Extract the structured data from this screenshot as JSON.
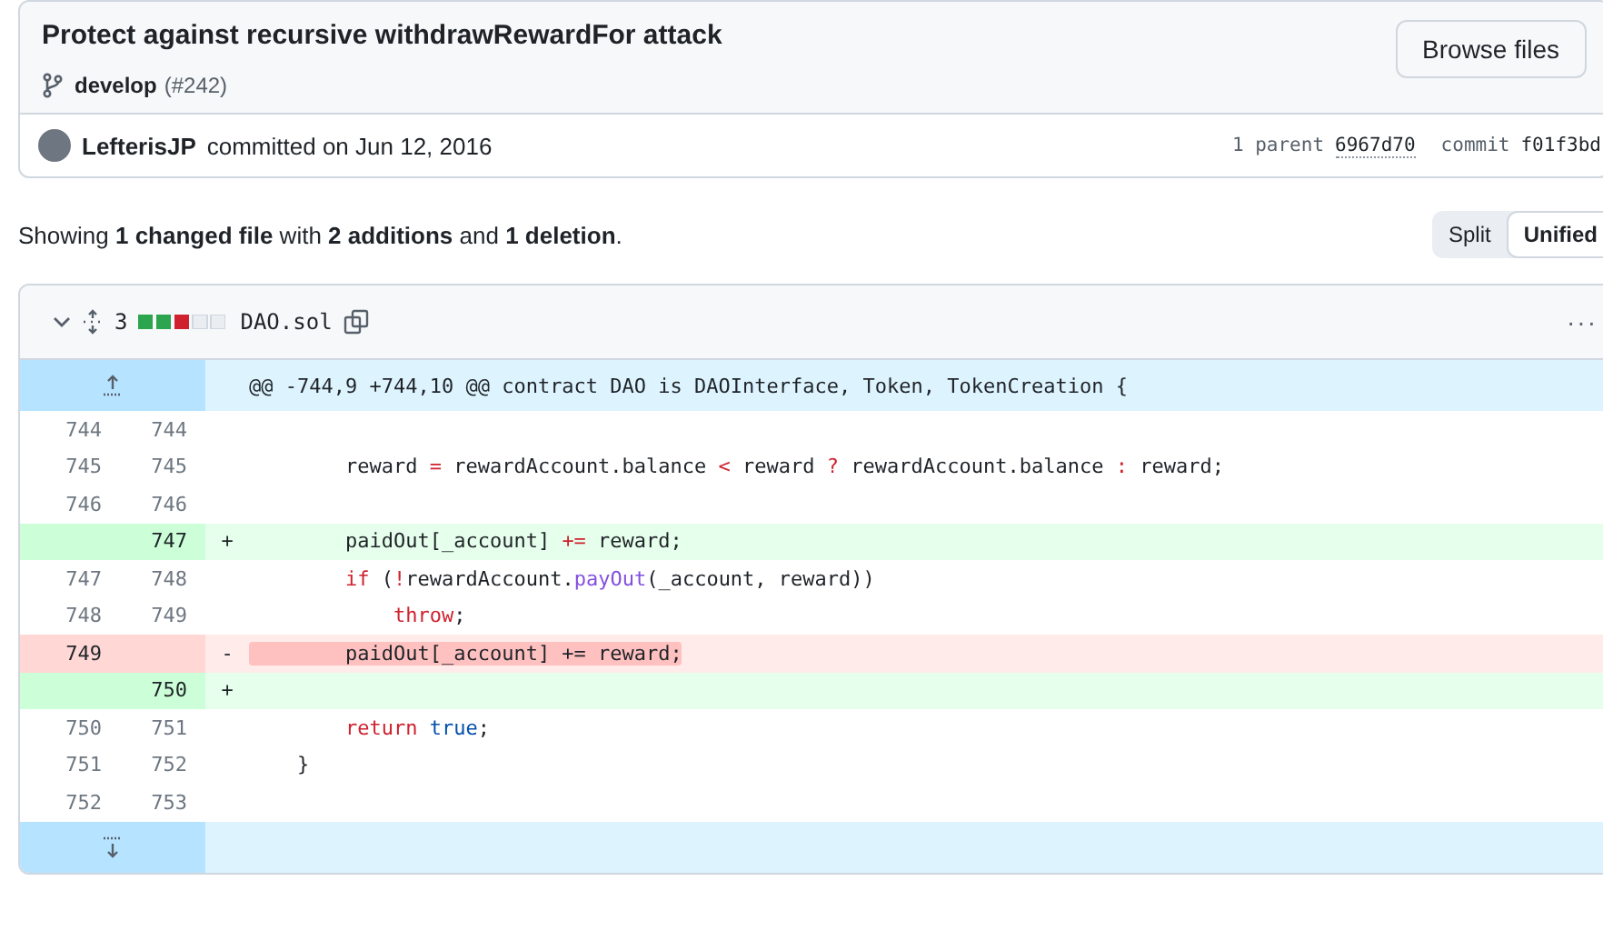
{
  "commit": {
    "title": "Protect against recursive withdrawRewardFor attack",
    "browse_button": "Browse files",
    "branch": "develop",
    "pr": "(#242)",
    "author": "LefterisJP",
    "committed": "committed on Jun 12, 2016",
    "parent_label": "1 parent",
    "parent_sha": "6967d70",
    "commit_label": "commit",
    "commit_sha": "f01f3bd"
  },
  "summary": {
    "text": "Showing **1 changed file** with **2 additions** and **1 deletion**.",
    "view_modes": [
      {
        "label": "Split",
        "selected": false
      },
      {
        "label": "Unified",
        "selected": true
      }
    ]
  },
  "file": {
    "expanded": true,
    "changes": "3",
    "diffstat": [
      {
        "kind": "added"
      },
      {
        "kind": "added"
      },
      {
        "kind": "deleted"
      },
      {
        "kind": "neutral"
      },
      {
        "kind": "neutral"
      }
    ],
    "name": "DAO.sol",
    "menu": "···"
  },
  "lines": [
    {
      "kind": "hunk",
      "tokens": [
        {
          "kind": "plain",
          "s": "@@ -744,9 +744,10 @@ contract DAO is DAOInterface, Token, TokenCreation {"
        }
      ]
    },
    {
      "kind": "context",
      "old": "744",
      "new": "744"
    },
    {
      "kind": "context",
      "old": "745",
      "new": "745",
      "tokens": [
        {
          "kind": "plain",
          "s": "        reward "
        },
        {
          "kind": "op",
          "s": "="
        },
        {
          "kind": "plain",
          "s": " rewardAccount.balance "
        },
        {
          "kind": "op",
          "s": "<"
        },
        {
          "kind": "plain",
          "s": " reward "
        },
        {
          "kind": "op",
          "s": "?"
        },
        {
          "kind": "plain",
          "s": " rewardAccount.balance "
        },
        {
          "kind": "op",
          "s": ":"
        },
        {
          "kind": "plain",
          "s": " reward;"
        }
      ]
    },
    {
      "kind": "context",
      "old": "746",
      "new": "746"
    },
    {
      "kind": "add",
      "new": "747",
      "sign": "+",
      "tokens": [
        {
          "kind": "plain",
          "s": "        paidOut[_account] "
        },
        {
          "kind": "op",
          "s": "+="
        },
        {
          "kind": "plain",
          "s": " reward;"
        }
      ]
    },
    {
      "kind": "context",
      "old": "747",
      "new": "748",
      "tokens": [
        {
          "kind": "op",
          "s": "        if"
        },
        {
          "kind": "plain",
          "s": " ("
        },
        {
          "kind": "op",
          "s": "!"
        },
        {
          "kind": "plain",
          "s": "rewardAccount."
        },
        {
          "kind": "func",
          "s": "payOut"
        },
        {
          "kind": "plain",
          "s": "(_account, reward))"
        }
      ]
    },
    {
      "kind": "context",
      "old": "748",
      "new": "749",
      "tokens": [
        {
          "kind": "op",
          "s": "            throw"
        },
        {
          "kind": "plain",
          "s": ";"
        }
      ]
    },
    {
      "kind": "del",
      "old": "749",
      "sign": "-",
      "tokens": [
        {
          "kind": "mark",
          "s": "        paidOut[_account] += reward;"
        }
      ]
    },
    {
      "kind": "add",
      "new": "750",
      "sign": "+"
    },
    {
      "kind": "context",
      "old": "750",
      "new": "751",
      "tokens": [
        {
          "kind": "op",
          "s": "        return "
        },
        {
          "kind": "const",
          "s": "true"
        },
        {
          "kind": "plain",
          "s": ";"
        }
      ]
    },
    {
      "kind": "context",
      "old": "751",
      "new": "752",
      "tokens": [
        {
          "kind": "plain",
          "s": "    }"
        }
      ]
    },
    {
      "kind": "context",
      "old": "752",
      "new": "753"
    },
    {
      "kind": "expand"
    }
  ]
}
